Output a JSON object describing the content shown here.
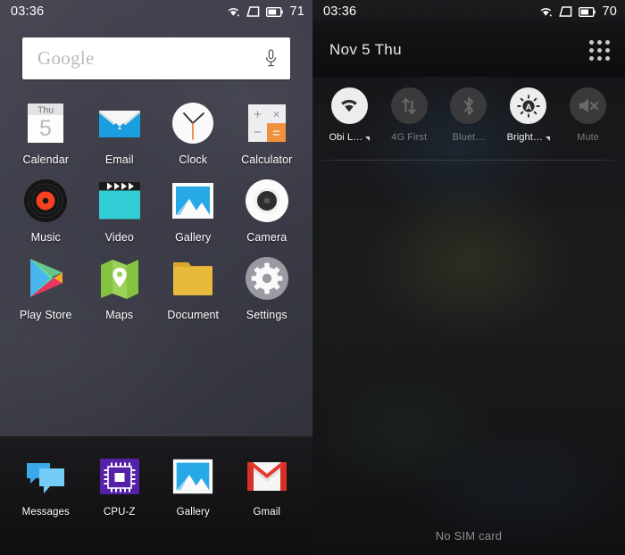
{
  "home": {
    "status_bar": {
      "time": "03:36",
      "battery_percent": "71",
      "icons": [
        "wifi-icon",
        "sim-icon",
        "battery-icon"
      ]
    },
    "search": {
      "placeholder": "Google",
      "mic_icon": "microphone-icon"
    },
    "app_rows": [
      [
        {
          "label": "Calendar",
          "icon": "calendar-icon",
          "weekday": "Thu",
          "day": "5"
        },
        {
          "label": "Email",
          "icon": "email-icon"
        },
        {
          "label": "Clock",
          "icon": "clock-icon"
        },
        {
          "label": "Calculator",
          "icon": "calculator-icon",
          "keys": [
            "+",
            "×",
            "−",
            "="
          ]
        }
      ],
      [
        {
          "label": "Music",
          "icon": "music-icon"
        },
        {
          "label": "Video",
          "icon": "video-icon"
        },
        {
          "label": "Gallery",
          "icon": "gallery-icon"
        },
        {
          "label": "Camera",
          "icon": "camera-icon"
        }
      ],
      [
        {
          "label": "Play Store",
          "icon": "play-store-icon"
        },
        {
          "label": "Maps",
          "icon": "maps-icon"
        },
        {
          "label": "Document",
          "icon": "document-folder-icon"
        },
        {
          "label": "Settings",
          "icon": "settings-gear-icon"
        }
      ]
    ],
    "dock": [
      {
        "label": "Messages",
        "icon": "messages-icon"
      },
      {
        "label": "CPU-Z",
        "icon": "cpuz-chip-icon"
      },
      {
        "label": "Gallery",
        "icon": "gallery-icon"
      },
      {
        "label": "Gmail",
        "icon": "gmail-icon"
      }
    ]
  },
  "shade": {
    "status_bar": {
      "time": "03:36",
      "battery_percent": "70",
      "icons": [
        "wifi-icon",
        "sim-icon",
        "battery-icon"
      ]
    },
    "header": {
      "date": "Nov 5  Thu",
      "grid_icon": "app-grid-icon"
    },
    "toggles": [
      {
        "label": "Obi L…",
        "icon": "wifi-icon",
        "state": "on",
        "expandable": true
      },
      {
        "label": "4G First",
        "icon": "data-icon",
        "state": "off",
        "expandable": false
      },
      {
        "label": "Bluet…",
        "icon": "bluetooth-icon",
        "state": "off",
        "expandable": false
      },
      {
        "label": "Bright…",
        "icon": "brightness-auto-icon",
        "state": "on",
        "expandable": true
      },
      {
        "label": "Mute",
        "icon": "mute-icon",
        "state": "off",
        "expandable": false
      }
    ],
    "footer": {
      "no_sim": "No SIM card"
    }
  },
  "colors": {
    "home_bg": "#3d3e4a",
    "dock_bg": "#151517",
    "shade_bg": "#18181b",
    "accent_orange": "#f2913d",
    "toggle_on": "#eceded",
    "toggle_off": "#3a3a3c"
  }
}
